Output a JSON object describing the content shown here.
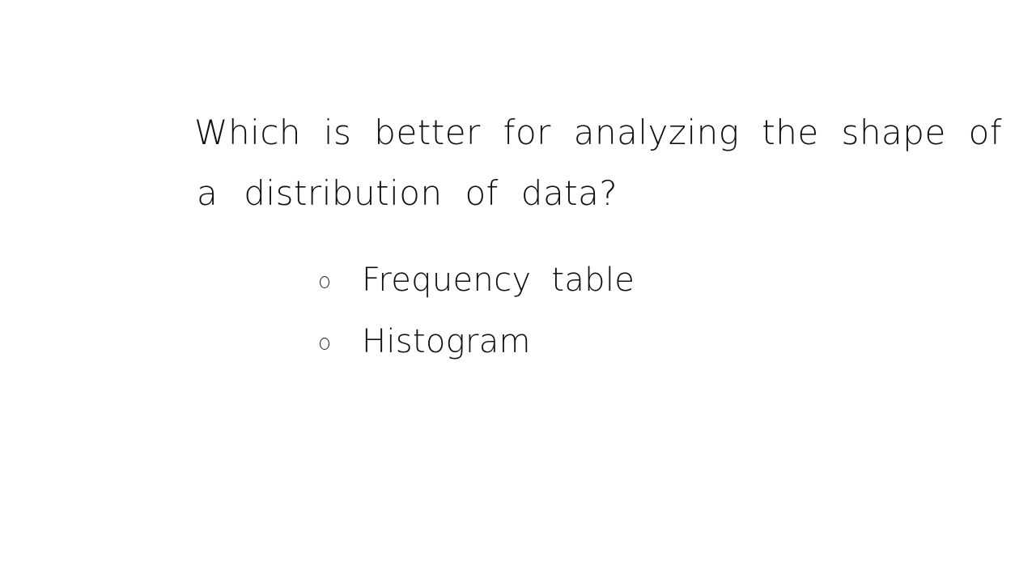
{
  "question": {
    "line1": "Which is better for analyzing the shape of",
    "line2_lead": "a",
    "line2_rest": "distribution of data?"
  },
  "options": [
    {
      "label": "Frequency table"
    },
    {
      "label": "Histogram"
    }
  ],
  "colors": {
    "ink": "#111111",
    "background": "#ffffff"
  },
  "icons": {
    "option_marker": "radio-circle-icon"
  }
}
